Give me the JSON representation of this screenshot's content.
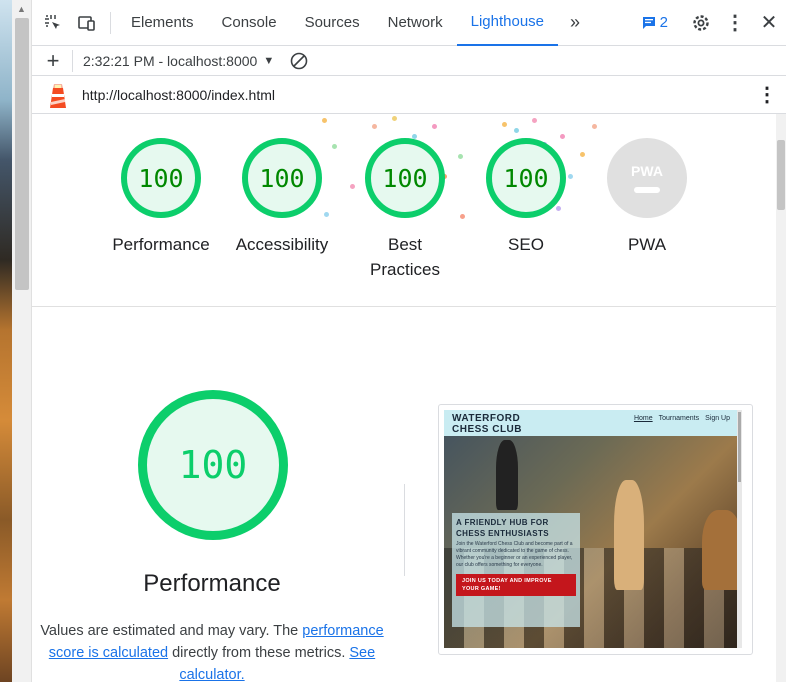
{
  "tabs": [
    "Elements",
    "Console",
    "Sources",
    "Network",
    "Lighthouse"
  ],
  "active_tab": "Lighthouse",
  "more_tabs_icon": "chevron-double-right-icon",
  "message_count": "2",
  "toolbar": {
    "report_selector": "2:32:21 PM - localhost:8000"
  },
  "url": "http://localhost:8000/index.html",
  "scores": [
    {
      "label": "Performance",
      "value": "100"
    },
    {
      "label": "Accessibility",
      "value": "100"
    },
    {
      "label": "Best Practices",
      "value": "100"
    },
    {
      "label": "SEO",
      "value": "100"
    },
    {
      "label": "PWA",
      "value": "PWA"
    }
  ],
  "performance": {
    "score": "100",
    "title": "Performance",
    "desc_1": "Values are estimated and may vary. The ",
    "desc_link": "performance score is calculated",
    "desc_2": " directly from these metrics. ",
    "desc_link_2": "See calculator."
  },
  "screenshot": {
    "logo_line1": "WATERFORD",
    "logo_line2": "CHESS CLUB",
    "nav": [
      "Home",
      "Tournaments",
      "Sign Up"
    ],
    "hero_title": "A FRIENDLY HUB FOR CHESS ENTHUSIASTS",
    "hero_text": "Join the Waterford Chess Club and become part of a vibrant community dedicated to the game of chess. Whether you're a beginner or an experienced player, our club offers something for everyone.",
    "hero_button": "JOIN US TODAY AND IMPROVE YOUR GAME!"
  },
  "colors": {
    "pass": "#0cce6b",
    "accent": "#1a73e8",
    "lighthouse_orange": "#f44b21"
  }
}
